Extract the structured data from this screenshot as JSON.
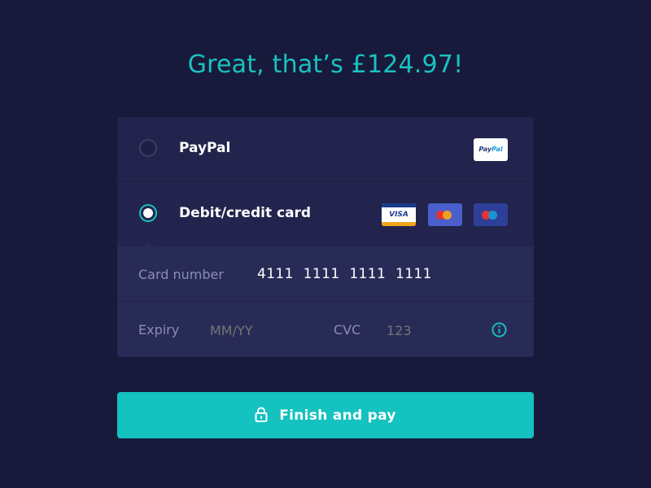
{
  "headline": "Great, that’s £124.97!",
  "payment_options": [
    {
      "label": "PayPal",
      "selected": false,
      "logos": [
        "paypal-logo"
      ]
    },
    {
      "label": "Debit/credit card",
      "selected": true,
      "logos": [
        "visa-logo",
        "mastercard-logo",
        "maestro-logo"
      ]
    }
  ],
  "logos": {
    "paypal_prefix": "Pay",
    "paypal_suffix": "Pal",
    "visa": "VISA"
  },
  "card_form": {
    "card_number_label": "Card number",
    "card_number_value": "4111 1111 1111 1111",
    "expiry_label": "Expiry",
    "expiry_placeholder": "MM/YY",
    "cvc_label": "CVC",
    "cvc_placeholder": "123",
    "info_icon": "info-icon"
  },
  "submit": {
    "label": "Finish and pay",
    "icon": "lock-icon"
  },
  "colors": {
    "background": "#181a3b",
    "panel": "#22244d",
    "accent": "#19c2c0",
    "button": "#14c2bf"
  }
}
